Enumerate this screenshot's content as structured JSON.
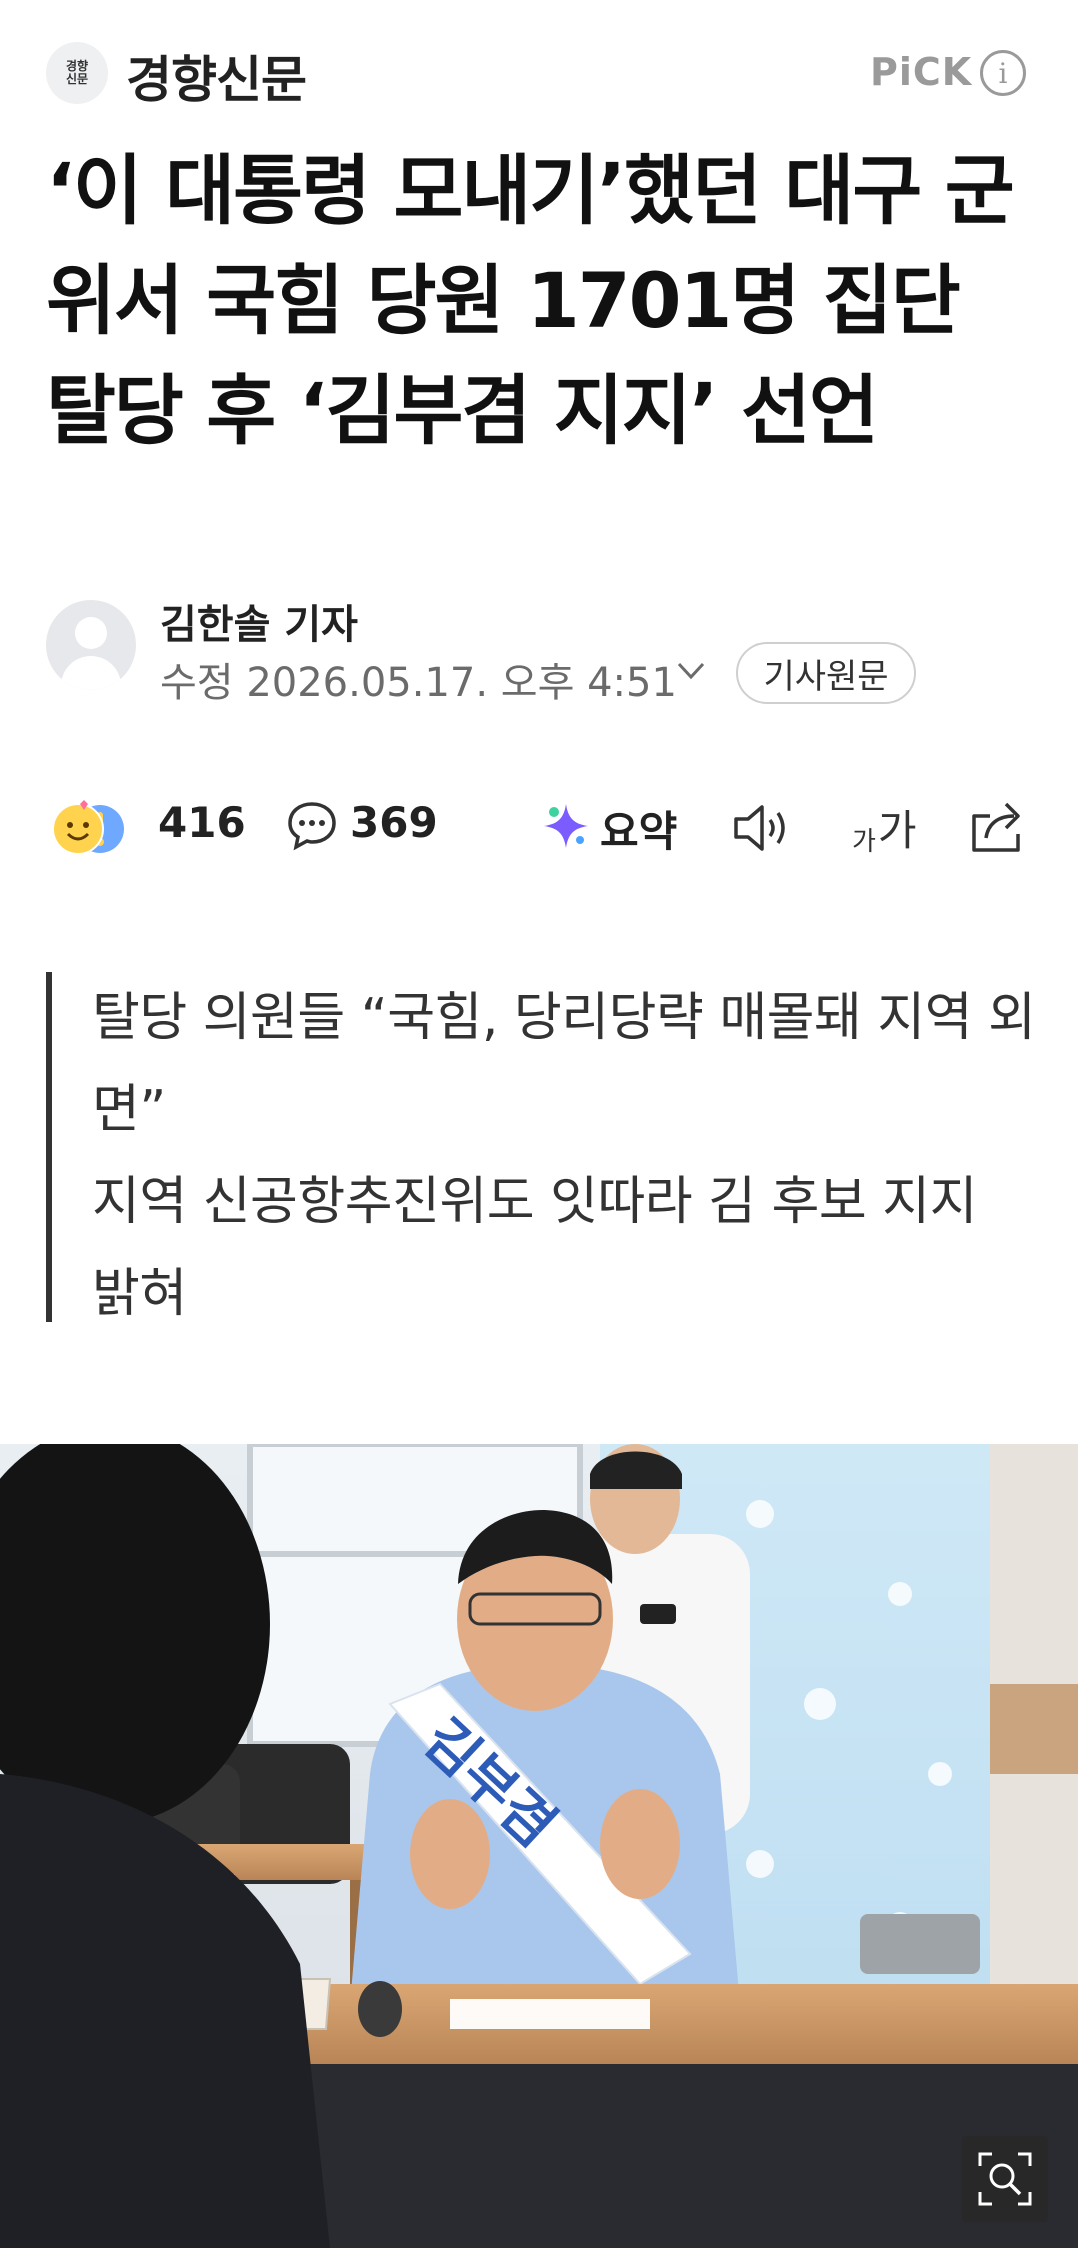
{
  "header": {
    "press_logo_text": "경향\n신문",
    "press_name": "경향신문",
    "pick_label": "PiCK"
  },
  "article": {
    "headline": "‘이 대통령 모내기’했던 대구 군위서 국힘 당원 1701명 집단 탈당 후 ‘김부겸 지지’ 선언",
    "reporter": "김한솔 기자",
    "modified_date": "수정 2026.05.17. 오후 4:51",
    "original_button": "기사원문"
  },
  "toolbar": {
    "reaction_count": "416",
    "comment_count": "369",
    "summary_label": "요약",
    "font_small": "가",
    "font_big": "가"
  },
  "subheadings": [
    "탈당 의원들 “국힘, 당리당략 매몰돼 지역 외면”",
    "지역 신공항추진위도 잇따라 김 후보 지지 밝혀"
  ],
  "photo": {
    "sash_text": "김부겸"
  },
  "colors": {
    "accent": "#222222",
    "muted": "#6b6b6b",
    "pick": "#9a9a9a"
  }
}
